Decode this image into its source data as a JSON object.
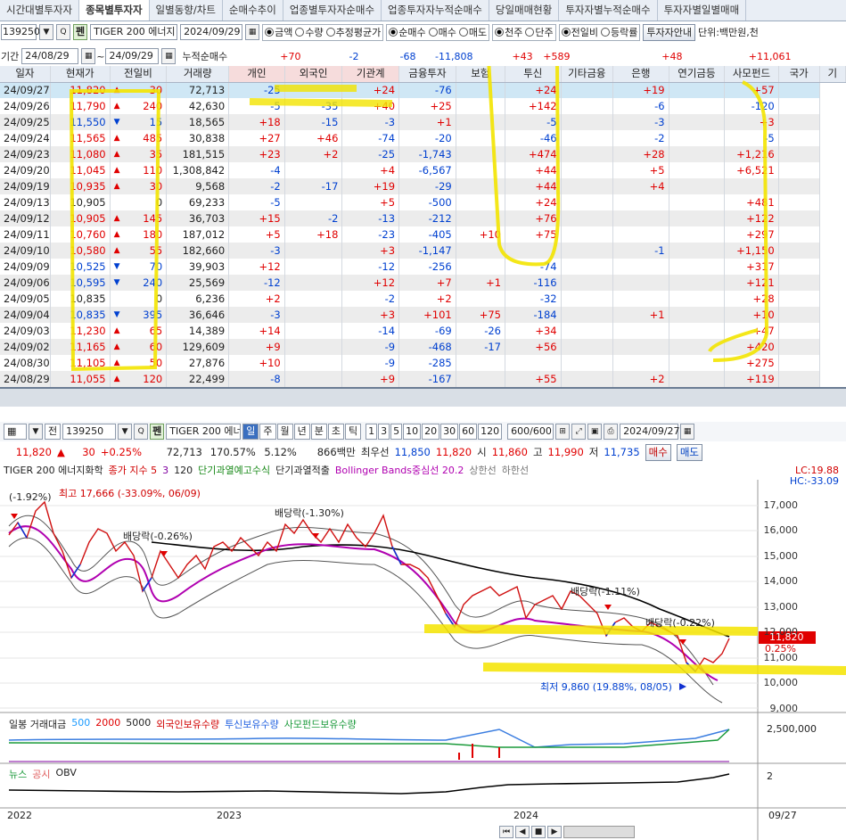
{
  "tabs": [
    "시간대별투자자",
    "종목별투자자",
    "일별동향/차트",
    "순매수추이",
    "업종별투자자순매수",
    "업종투자자누적순매수",
    "당일매매현황",
    "투자자별누적순매수",
    "투자자별일별매매"
  ],
  "toolbar": {
    "code": "139250",
    "search_btn": "Q",
    "pen_btn": "펜",
    "name": "TIGER 200 에너지",
    "date": "2024/09/29",
    "opt_amount": "금액",
    "opt_qty": "수량",
    "opt_avg": "추정평균가",
    "opt_net": "순매수",
    "opt_buy": "매수",
    "opt_sell": "매도",
    "opt_thousand": "천주",
    "opt_single": "단주",
    "opt_prevday": "전일비",
    "opt_rate": "등락률",
    "guide_btn": "투자자안내",
    "unit": "단위:백만원,천"
  },
  "period": {
    "label": "기간",
    "from": "24/08/29",
    "to": "24/09/29",
    "cum_label": "누적순매수",
    "cum": [
      "+70",
      "-2",
      "-68",
      "-11,808",
      "",
      "+43",
      "+589",
      "",
      "+48",
      "",
      "+11,061"
    ]
  },
  "headers": [
    "일자",
    "현재가",
    "전일비",
    "거래량",
    "개인",
    "외국인",
    "기관계",
    "금융투자",
    "보험",
    "투신",
    "기타금융",
    "은행",
    "연기금등",
    "사모펀드",
    "국가",
    "기"
  ],
  "rows": [
    [
      "24/09/27",
      "11,820",
      "up",
      "30",
      "72,713",
      "-25",
      "",
      "+24",
      "-76",
      "",
      "+24",
      "",
      "+19",
      "",
      "+57",
      ""
    ],
    [
      "24/09/26",
      "11,790",
      "up",
      "240",
      "42,630",
      "-5",
      "-35",
      "+40",
      "+25",
      "",
      "+142",
      "",
      "-6",
      "",
      "-120",
      ""
    ],
    [
      "24/09/25",
      "11,550",
      "dn",
      "15",
      "18,565",
      "+18",
      "-15",
      "-3",
      "+1",
      "",
      "-5",
      "",
      "-3",
      "",
      "+3",
      ""
    ],
    [
      "24/09/24",
      "11,565",
      "up",
      "485",
      "30,838",
      "+27",
      "+46",
      "-74",
      "-20",
      "",
      "-46",
      "",
      "-2",
      "",
      "-5",
      ""
    ],
    [
      "24/09/23",
      "11,080",
      "up",
      "35",
      "181,515",
      "+23",
      "+2",
      "-25",
      "-1,743",
      "",
      "+474",
      "",
      "+28",
      "",
      "+1,216",
      ""
    ],
    [
      "24/09/20",
      "11,045",
      "up",
      "110",
      "1,308,842",
      "-4",
      "",
      "+4",
      "-6,567",
      "",
      "+44",
      "",
      "+5",
      "",
      "+6,521",
      ""
    ],
    [
      "24/09/19",
      "10,935",
      "up",
      "30",
      "9,568",
      "-2",
      "-17",
      "+19",
      "-29",
      "",
      "+44",
      "",
      "+4",
      "",
      "",
      ""
    ],
    [
      "24/09/13",
      "10,905",
      "",
      "0",
      "69,233",
      "-5",
      "",
      "+5",
      "-500",
      "",
      "+24",
      "",
      "",
      "",
      "+481",
      ""
    ],
    [
      "24/09/12",
      "10,905",
      "up",
      "145",
      "36,703",
      "+15",
      "-2",
      "-13",
      "-212",
      "",
      "+76",
      "",
      "",
      "",
      "+122",
      ""
    ],
    [
      "24/09/11",
      "10,760",
      "up",
      "180",
      "187,012",
      "+5",
      "+18",
      "-23",
      "-405",
      "+10",
      "+75",
      "",
      "",
      "",
      "+297",
      ""
    ],
    [
      "24/09/10",
      "10,580",
      "up",
      "55",
      "182,660",
      "-3",
      "",
      "+3",
      "-1,147",
      "",
      "",
      "",
      "-1",
      "",
      "+1,150",
      ""
    ],
    [
      "24/09/09",
      "10,525",
      "dn",
      "70",
      "39,903",
      "+12",
      "",
      "-12",
      "-256",
      "",
      "-74",
      "",
      "",
      "",
      "+317",
      ""
    ],
    [
      "24/09/06",
      "10,595",
      "dn",
      "240",
      "25,569",
      "-12",
      "",
      "+12",
      "+7",
      "+1",
      "-116",
      "",
      "",
      "",
      "+121",
      ""
    ],
    [
      "24/09/05",
      "10,835",
      "",
      "0",
      "6,236",
      "+2",
      "",
      "-2",
      "+2",
      "",
      "-32",
      "",
      "",
      "",
      "+28",
      ""
    ],
    [
      "24/09/04",
      "10,835",
      "dn",
      "395",
      "36,646",
      "-3",
      "",
      "+3",
      "+101",
      "+75",
      "-184",
      "",
      "+1",
      "",
      "+10",
      ""
    ],
    [
      "24/09/03",
      "11,230",
      "up",
      "65",
      "14,389",
      "+14",
      "",
      "-14",
      "-69",
      "-26",
      "+34",
      "",
      "",
      "",
      "+47",
      ""
    ],
    [
      "24/09/02",
      "11,165",
      "up",
      "60",
      "129,609",
      "+9",
      "",
      "-9",
      "-468",
      "-17",
      "+56",
      "",
      "",
      "",
      "+420",
      ""
    ],
    [
      "24/08/30",
      "11,105",
      "up",
      "50",
      "27,876",
      "+10",
      "",
      "-9",
      "-285",
      "",
      "",
      "",
      "",
      "",
      "+275",
      ""
    ],
    [
      "24/08/29",
      "11,055",
      "up",
      "120",
      "22,499",
      "-8",
      "",
      "+9",
      "-167",
      "",
      "+55",
      "",
      "+2",
      "",
      "+119",
      ""
    ]
  ],
  "chart_toolbar": {
    "period_btns": [
      "일",
      "주",
      "월",
      "년",
      "분",
      "초",
      "틱"
    ],
    "num_btns": [
      "1",
      "3",
      "5",
      "10",
      "20",
      "30",
      "60",
      "120"
    ],
    "count": "600/600",
    "date": "2024/09/27",
    "buy": "매수",
    "sell": "매도"
  },
  "quote": {
    "price": "11,820",
    "change": "30",
    "rate": "+0.25%",
    "volume": "72,713",
    "turnover": "170.57%",
    "ratio": "5.12%",
    "amount": "866백만",
    "best_label": "최우선",
    "ask": "11,850",
    "bid": "11,820",
    "open_label": "시",
    "open": "11,860",
    "high_label": "고",
    "high": "11,990",
    "low_label": "저",
    "low": "11,735"
  },
  "legend": {
    "name": "TIGER 200 에너지화학",
    "close_label": "종가 지수 5",
    "ma1": "3",
    "ma2": "120",
    "ind1": "단기과열예고수식",
    "ind2": "단기과열적출",
    "boll": "Bollinger Bands중심선 20.2",
    "upper": "상한선",
    "lower": "하한선",
    "lc": "LC:19.88",
    "hc": "HC:-33.09"
  },
  "annotations": {
    "high": "최고 17,666 (-33.09%, 06/09)",
    "low": "최저 9,860 (19.88%, 08/05)",
    "div1": "배당락(-1.30%)",
    "div2": "배당락(-0.26%)",
    "div3": "배당락(-1.11%)",
    "div4": "배당락(-0.22%)",
    "left": "(-1.92%)",
    "price_tag": "11,820",
    "rate_tag": "0.25%"
  },
  "y_ticks": [
    "17,000",
    "16,000",
    "15,000",
    "14,000",
    "13,000",
    "12,000",
    "11,000",
    "10,000",
    "9,000"
  ],
  "sub1": {
    "label": "일봉 거래대금",
    "n1": "500",
    "n2": "2000",
    "n3": "5000",
    "s1": "외국인보유수량",
    "s2": "투신보유수량",
    "s3": "사모펀드보유수량",
    "tick": "2,500,000"
  },
  "sub2": {
    "l1": "뉴스",
    "l2": "공시",
    "l3": "OBV",
    "tick": "2"
  },
  "x_ticks": [
    "2022",
    "2023",
    "2024",
    "09/27"
  ],
  "colors": {
    "up": "#e00000",
    "down": "#0040d0",
    "highlight": "#f5e400"
  }
}
